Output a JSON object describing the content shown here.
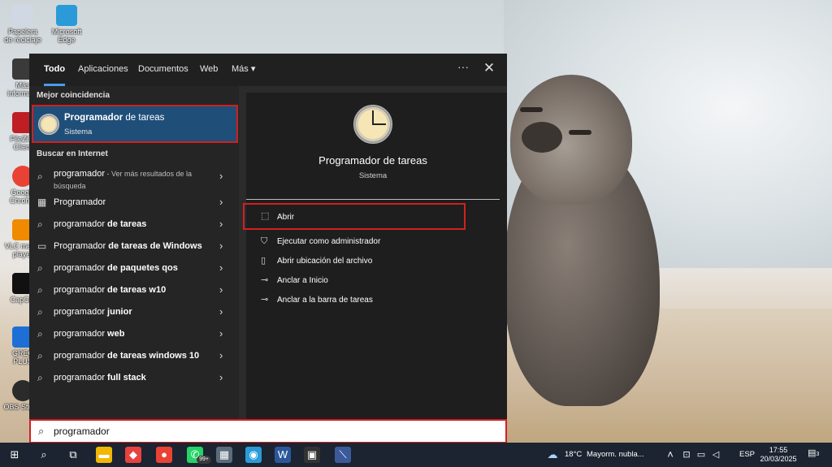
{
  "desktop_icons": [
    {
      "label": "Papelera de reciclaje",
      "color": "#cfd8e3"
    },
    {
      "label": "Microsoft Edge",
      "color": "#2a9bd8"
    },
    {
      "label": "Más informa...",
      "color": "#3a3a3a"
    },
    {
      "label": "FileZilla Client",
      "color": "#bf1e24"
    },
    {
      "label": "Google Chrome",
      "color": "#e94235"
    },
    {
      "label": "VLC media player",
      "color": "#f08a00"
    },
    {
      "label": "CapCut",
      "color": "#111111"
    },
    {
      "label": "GREC PLUS",
      "color": "#1d6fd6"
    },
    {
      "label": "OBS Studio",
      "color": "#2b2b2b"
    }
  ],
  "tabs": [
    {
      "label": "Todo",
      "active": true
    },
    {
      "label": "Aplicaciones",
      "active": false
    },
    {
      "label": "Documentos",
      "active": false
    },
    {
      "label": "Web",
      "active": false
    },
    {
      "label": "Más ▾",
      "active": false
    }
  ],
  "tab_actions": {
    "more": "···",
    "close": "✕"
  },
  "best_match": {
    "section": "Mejor coincidencia",
    "title_bold": "Programador",
    "title_rest": " de tareas",
    "subtitle": "Sistema"
  },
  "web_section": "Buscar en Internet",
  "web_results": [
    {
      "icon": "search-icon",
      "plain": "programador",
      "bold": "",
      "muted": " - Ver más resultados de la búsqueda"
    },
    {
      "icon": "thumbnail-icon",
      "plain": "Programador",
      "bold": "",
      "muted": ""
    },
    {
      "icon": "search-icon",
      "plain": "programador ",
      "bold": "de tareas",
      "muted": ""
    },
    {
      "icon": "window-icon",
      "plain": "Programador ",
      "bold": "de tareas de Windows",
      "muted": ""
    },
    {
      "icon": "search-icon",
      "plain": "programador ",
      "bold": "de paquetes qos",
      "muted": ""
    },
    {
      "icon": "search-icon",
      "plain": "programador ",
      "bold": "de tareas w10",
      "muted": ""
    },
    {
      "icon": "search-icon",
      "plain": "programador ",
      "bold": "junior",
      "muted": ""
    },
    {
      "icon": "search-icon",
      "plain": "programador ",
      "bold": "web",
      "muted": ""
    },
    {
      "icon": "search-icon",
      "plain": "programador ",
      "bold": "de tareas windows 10",
      "muted": ""
    },
    {
      "icon": "search-icon",
      "plain": "programador ",
      "bold": "full stack",
      "muted": ""
    }
  ],
  "preview": {
    "name": "Programador de tareas",
    "type": "Sistema",
    "actions": [
      {
        "icon": "open-icon",
        "glyph": "⬚",
        "label": "Abrir"
      },
      {
        "icon": "shield-icon",
        "glyph": "⛉",
        "label": "Ejecutar como administrador"
      },
      {
        "icon": "file-location-icon",
        "glyph": "▯",
        "label": "Abrir ubicación del archivo"
      },
      {
        "icon": "pin-icon",
        "glyph": "⊸",
        "label": "Anclar a Inicio"
      },
      {
        "icon": "pin-taskbar-icon",
        "glyph": "⊸",
        "label": "Anclar a la barra de tareas"
      }
    ]
  },
  "search": {
    "value": "programador",
    "placeholder": ""
  },
  "taskbar": {
    "weather_temp": "18°C",
    "weather_desc": "Mayorm. nubla...",
    "language": "ESP",
    "time": "17:55",
    "date": "20/03/2025",
    "notifications": "3",
    "whatsapp_badge": "99+",
    "apps": [
      {
        "name": "windows-start-icon",
        "glyph": "⊞",
        "color": "#1b2430"
      },
      {
        "name": "search-icon",
        "glyph": "⌕",
        "color": "#1b2430"
      },
      {
        "name": "task-view-icon",
        "glyph": "⧉",
        "color": "#1b2430"
      },
      {
        "name": "file-explorer-icon",
        "glyph": "▬",
        "color": "#f2b705"
      },
      {
        "name": "anydesk-icon",
        "glyph": "◆",
        "color": "#e8423f"
      },
      {
        "name": "chrome-icon",
        "glyph": "●",
        "color": "#e94235"
      },
      {
        "name": "whatsapp-icon",
        "glyph": "✆",
        "color": "#25d366"
      },
      {
        "name": "app-icon",
        "glyph": "▦",
        "color": "#5a6b7a"
      },
      {
        "name": "edge-icon",
        "glyph": "◉",
        "color": "#2a9bd8"
      },
      {
        "name": "word-icon",
        "glyph": "W",
        "color": "#2b579a"
      },
      {
        "name": "terminal-icon",
        "glyph": "▣",
        "color": "#333333"
      },
      {
        "name": "app2-icon",
        "glyph": "⟍",
        "color": "#3c5a9a"
      }
    ]
  }
}
